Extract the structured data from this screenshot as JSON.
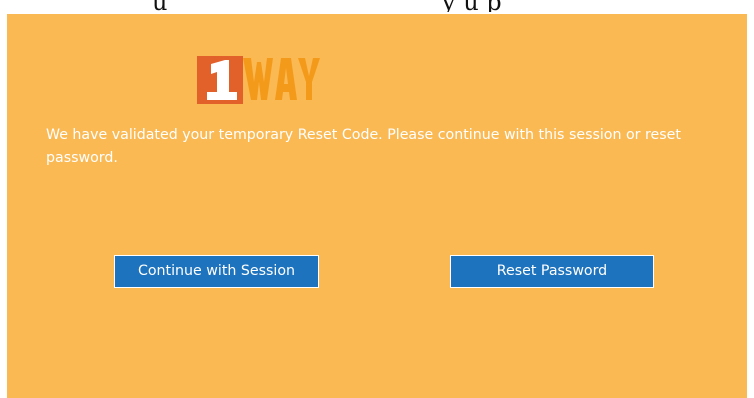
{
  "page": {
    "clipped_text_left": "u",
    "clipped_text_right": "y   u      p"
  },
  "logo": {
    "text": "1WAY",
    "colors": {
      "badge": "#e2602a",
      "digit": "#ffffff",
      "word": "#f49a1a"
    }
  },
  "message": "We have validated your temporary Reset Code. Please continue with this session or reset password.",
  "buttons": {
    "continue_label": "Continue with Session",
    "reset_label": "Reset Password"
  },
  "colors": {
    "panel_background": "#fbb954",
    "button_background": "#1e73be",
    "text": "#ffffff"
  }
}
